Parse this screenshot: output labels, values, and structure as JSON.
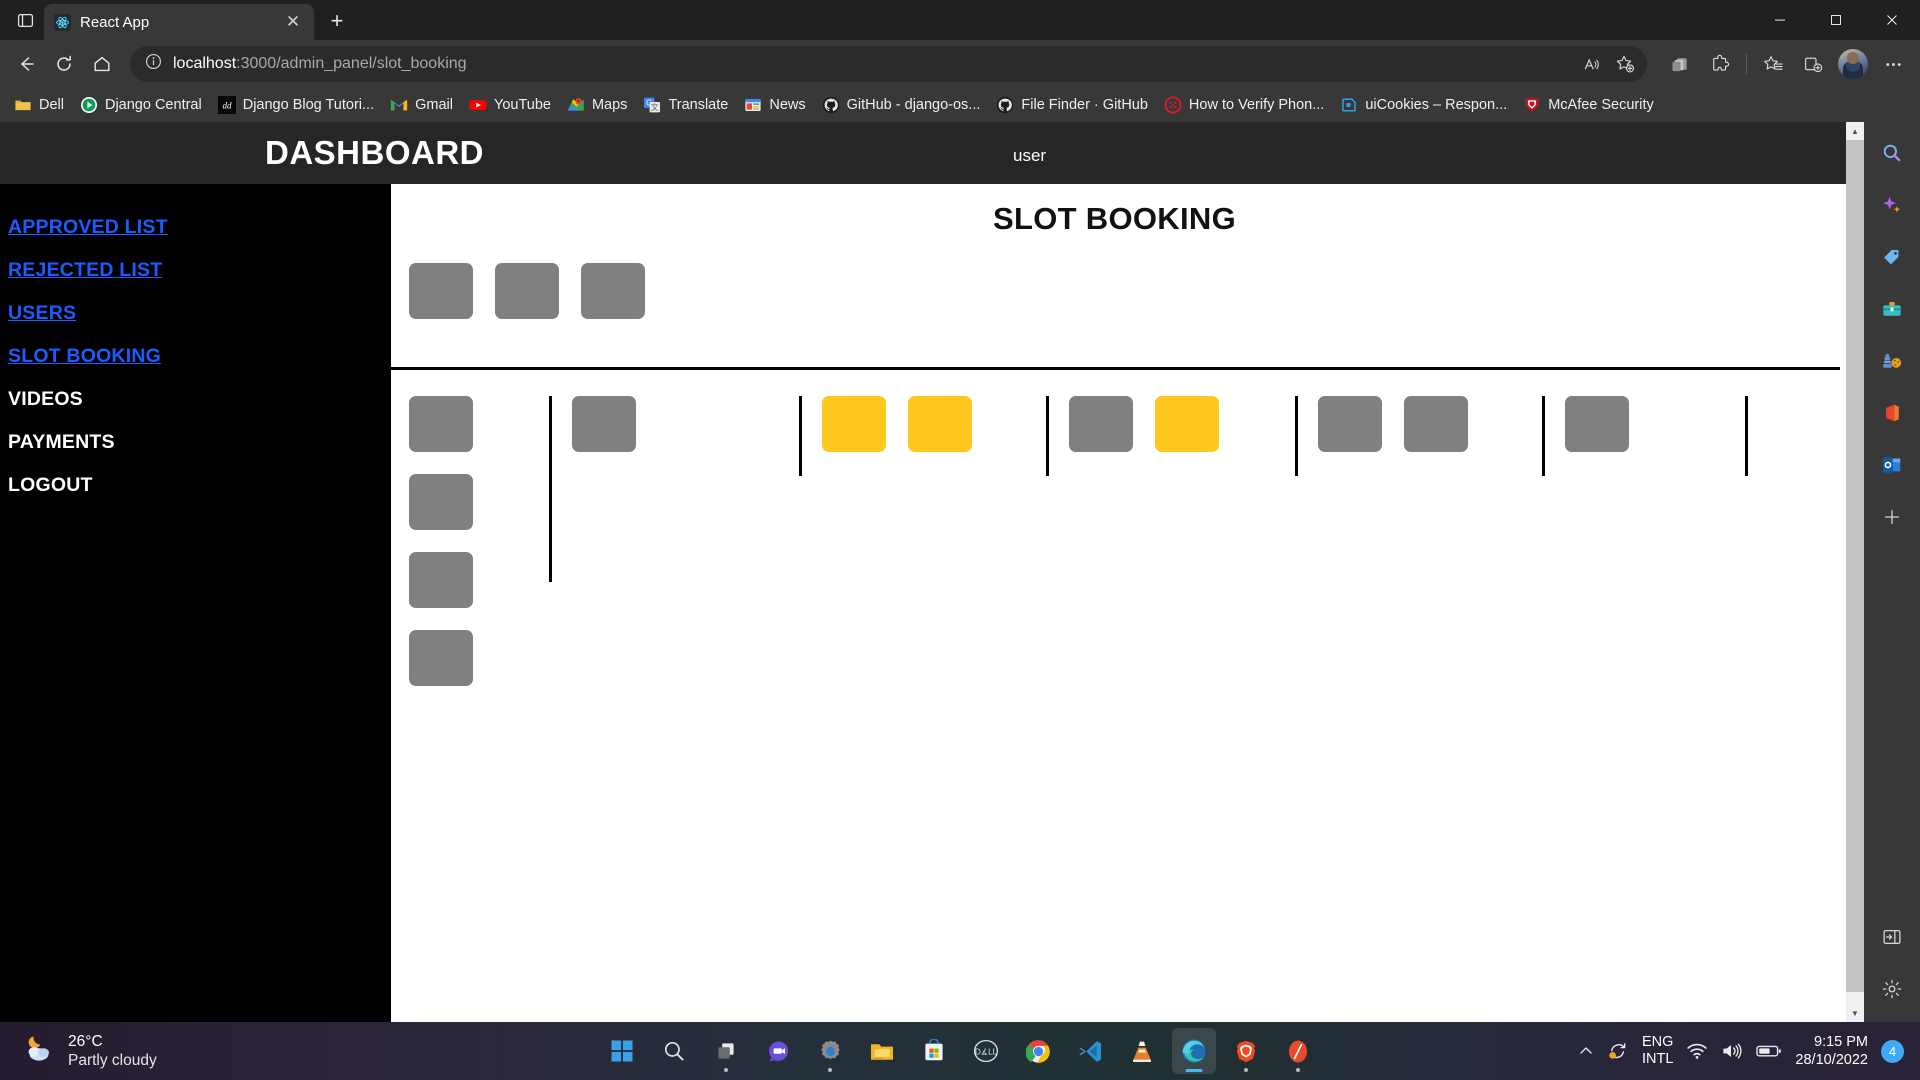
{
  "browser": {
    "tab": {
      "title": "React App",
      "favicon": "react-icon",
      "close": "✕"
    },
    "new_tab_label": "+",
    "window_controls": {
      "minimize": "─",
      "maximize": "☐",
      "close": "✕"
    },
    "nav": {
      "back": "←",
      "refresh": "↻",
      "home": "⌂"
    },
    "omnibox": {
      "info_icon": "info-icon",
      "url_host": "localhost",
      "url_path": ":3000/admin_panel/slot_booking",
      "read_aloud": "read-aloud-icon",
      "add_favorite": "add-favorite-icon"
    },
    "toolbar_right": [
      {
        "name": "collections-icon",
        "glyph": "❐"
      },
      {
        "name": "extensions-icon",
        "glyph": "⬡"
      },
      {
        "name": "favorites-icon",
        "glyph": "☆"
      },
      {
        "name": "split-screen-icon",
        "glyph": "⧉"
      },
      {
        "name": "profile-avatar",
        "glyph": ""
      },
      {
        "name": "settings-more-icon",
        "glyph": "⋯"
      }
    ],
    "bookmarks": [
      {
        "label": "Dell",
        "icon": "folder-icon"
      },
      {
        "label": "Django Central",
        "icon": "django-central-icon"
      },
      {
        "label": "Django Blog Tutori...",
        "icon": "django-blog-icon"
      },
      {
        "label": "Gmail",
        "icon": "gmail-icon"
      },
      {
        "label": "YouTube",
        "icon": "youtube-icon"
      },
      {
        "label": "Maps",
        "icon": "maps-icon"
      },
      {
        "label": "Translate",
        "icon": "translate-icon"
      },
      {
        "label": "News",
        "icon": "news-icon"
      },
      {
        "label": "GitHub - django-os...",
        "icon": "github-icon"
      },
      {
        "label": "File Finder · GitHub",
        "icon": "github-icon"
      },
      {
        "label": "How to Verify Phon...",
        "icon": "red-circle-icon"
      },
      {
        "label": "uiCookies – Respon...",
        "icon": "uicookies-icon"
      },
      {
        "label": "McAfee Security",
        "icon": "mcafee-icon"
      }
    ],
    "edge_sidebar": [
      {
        "name": "search-icon",
        "glyph": "🔍"
      },
      {
        "name": "discover-copilot-icon",
        "glyph": "✦"
      },
      {
        "name": "shopping-tag-icon",
        "glyph": "🏷"
      },
      {
        "name": "tools-icon",
        "glyph": "🧰"
      },
      {
        "name": "games-icon",
        "glyph": "♟"
      },
      {
        "name": "office-icon",
        "glyph": "⬟"
      },
      {
        "name": "outlook-icon",
        "glyph": "◔"
      },
      {
        "name": "add-sidebar-app-icon",
        "glyph": "＋"
      }
    ],
    "sidebar_bottom": [
      {
        "name": "customize-sidebar-icon",
        "glyph": "❐"
      },
      {
        "name": "sidebar-settings-icon",
        "glyph": "⚙"
      }
    ]
  },
  "app": {
    "header": {
      "title": "DASHBOARD",
      "user": "user"
    },
    "sidebar": {
      "items": [
        {
          "label": "APPROVED LIST",
          "style": "link"
        },
        {
          "label": "REJECTED LIST",
          "style": "link"
        },
        {
          "label": "USERS",
          "style": "link"
        },
        {
          "label": "SLOT BOOKING",
          "style": "link"
        },
        {
          "label": "VIDEOS",
          "style": "plain"
        },
        {
          "label": "PAYMENTS",
          "style": "plain"
        },
        {
          "label": "LOGOUT",
          "style": "plain"
        }
      ]
    },
    "content": {
      "title": "SLOT BOOKING",
      "colors": {
        "available": "#808080",
        "booked": "#FFC81E"
      },
      "top_row": {
        "slots": [
          "available",
          "available",
          "available"
        ]
      },
      "groups": [
        {
          "slots": [
            "available",
            "available",
            "available",
            "available"
          ]
        },
        {
          "slots": [
            "available"
          ]
        },
        {
          "slots": [
            "booked",
            "booked"
          ]
        },
        {
          "slots": [
            "available",
            "booked"
          ]
        },
        {
          "slots": [
            "available",
            "available"
          ]
        },
        {
          "slots": [
            "available"
          ]
        }
      ]
    }
  },
  "taskbar": {
    "weather": {
      "temp": "26°C",
      "condition": "Partly cloudy",
      "icon": "partly-cloudy-night-icon"
    },
    "apps": [
      {
        "name": "start-button",
        "glyph": "start",
        "state": "idle"
      },
      {
        "name": "search-button",
        "glyph": "search",
        "state": "idle"
      },
      {
        "name": "task-view-button",
        "glyph": "taskview",
        "state": "running"
      },
      {
        "name": "chat-teams-button",
        "glyph": "teams",
        "state": "idle"
      },
      {
        "name": "settings-button",
        "glyph": "settings",
        "state": "running"
      },
      {
        "name": "file-explorer-button",
        "glyph": "explorer",
        "state": "idle"
      },
      {
        "name": "microsoft-store-button",
        "glyph": "store",
        "state": "idle"
      },
      {
        "name": "dell-button",
        "glyph": "dell",
        "state": "idle"
      },
      {
        "name": "chrome-button",
        "glyph": "chrome",
        "state": "running"
      },
      {
        "name": "vscode-button",
        "glyph": "vscode",
        "state": "running"
      },
      {
        "name": "vlc-button",
        "glyph": "vlc",
        "state": "idle"
      },
      {
        "name": "edge-button",
        "glyph": "edge",
        "state": "active"
      },
      {
        "name": "brave-button",
        "glyph": "brave",
        "state": "running"
      },
      {
        "name": "opera-gx-button",
        "glyph": "opera",
        "state": "running"
      }
    ],
    "tray": {
      "show_hidden": "∧",
      "onedrive_sync": "onedrive-sync-icon",
      "language": {
        "line1": "ENG",
        "line2": "INTL"
      },
      "network": "wifi-icon",
      "volume": "volume-icon",
      "battery": "battery-icon",
      "time": "9:15 PM",
      "date": "28/10/2022",
      "notification_count": "4"
    }
  }
}
